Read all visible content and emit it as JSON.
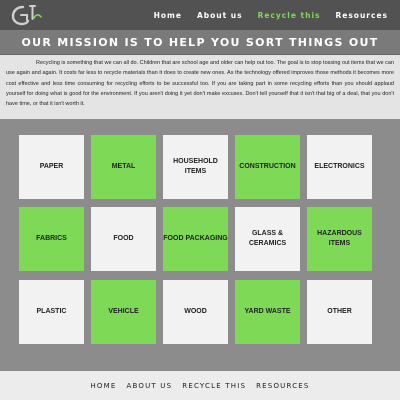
{
  "nav": {
    "items": [
      "Home",
      "About us",
      "Recycle this",
      "Resources"
    ],
    "active_index": 2
  },
  "mission": {
    "title": "OUR MISSION IS TO HELP YOU SORT THINGS OUT",
    "text": "Recycling is something that we can all do. Children that are school age and older can help out too. The goal is to stop tossing out items that we can use again and again. It costs far less to recycle materials than it does to create new ones. As the technology offered improves those methods it becomes more cost effective and less time consuming for recycling efforts to be successful too. If you are taking part in some recycling efforts than you should applaud yourself for doing what is good for the environment. If you aren't doing it yet don't make excuses. Don't tell yourself that it isn't that big of a deal, that you don't have time, or that it isn't worth it."
  },
  "categories": [
    {
      "label": "PAPER",
      "style": "white"
    },
    {
      "label": "METAL",
      "style": "green"
    },
    {
      "label": "HOUSEHOLD ITEMS",
      "style": "white"
    },
    {
      "label": "CONSTRUCTION",
      "style": "green"
    },
    {
      "label": "ELECTRONICS",
      "style": "white"
    },
    {
      "label": "FABRICS",
      "style": "green"
    },
    {
      "label": "FOOD",
      "style": "white"
    },
    {
      "label": "FOOD PACKAGING",
      "style": "green"
    },
    {
      "label": "GLASS & CERAMICS",
      "style": "white"
    },
    {
      "label": "HAZARDOUS ITEMS",
      "style": "green"
    },
    {
      "label": "PLASTIC",
      "style": "white"
    },
    {
      "label": "VEHICLE",
      "style": "green"
    },
    {
      "label": "WOOD",
      "style": "white"
    },
    {
      "label": "YARD WASTE",
      "style": "green"
    },
    {
      "label": "OTHER",
      "style": "white"
    }
  ],
  "footer": {
    "items": [
      "HOME",
      "ABOUT US",
      "RECYCLE THIS",
      "RESOURCES"
    ]
  },
  "colors": {
    "accent_green": "#7ed957",
    "header_bg": "#525252",
    "page_bg": "#8c8c8c"
  }
}
